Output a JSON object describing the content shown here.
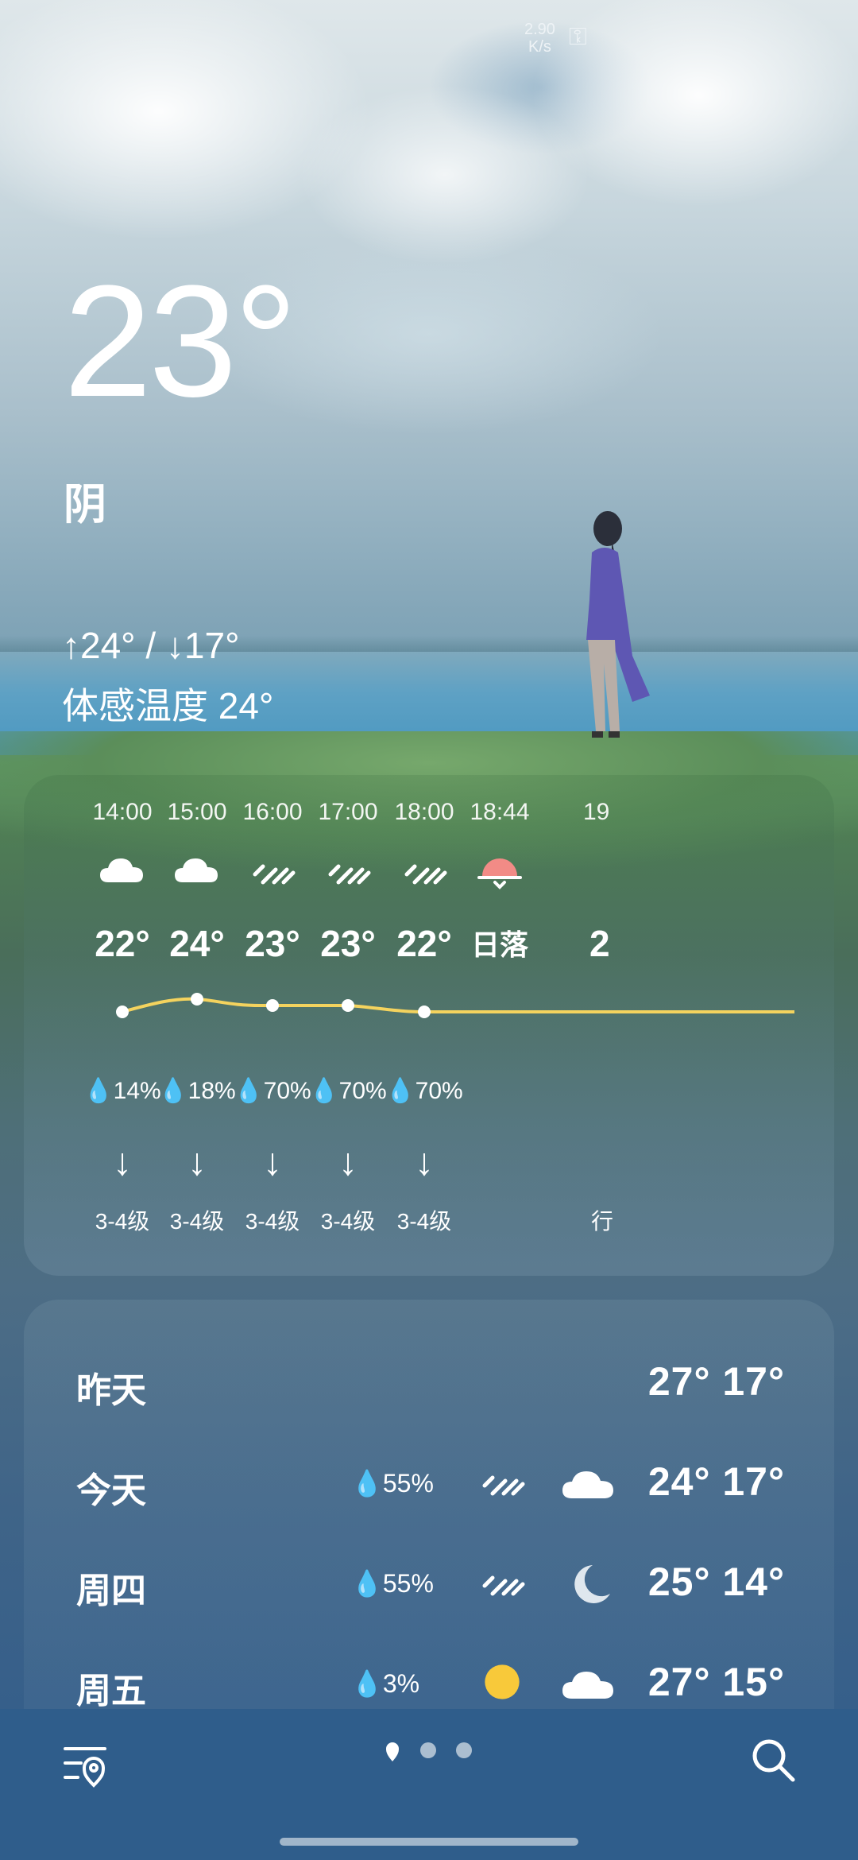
{
  "status_bar": {
    "net_speed": "2.90",
    "net_unit": "K/s",
    "key_icon": "key-icon"
  },
  "current": {
    "temperature": "23°",
    "condition": "阴",
    "high_low": "↑24° / ↓17°",
    "feels_like": "体感温度 24°"
  },
  "hourly": [
    {
      "time": "14:00",
      "icon": "cloud-icon",
      "temp": "22°",
      "precip": "14%",
      "wind_dir": "↓",
      "wind": "3-4级"
    },
    {
      "time": "15:00",
      "icon": "cloud-icon",
      "temp": "24°",
      "precip": "18%",
      "wind_dir": "↓",
      "wind": "3-4级"
    },
    {
      "time": "16:00",
      "icon": "rain-icon",
      "temp": "23°",
      "precip": "70%",
      "wind_dir": "↓",
      "wind": "3-4级"
    },
    {
      "time": "17:00",
      "icon": "rain-icon",
      "temp": "23°",
      "precip": "70%",
      "wind_dir": "↓",
      "wind": "3-4级"
    },
    {
      "time": "18:00",
      "icon": "rain-icon",
      "temp": "22°",
      "precip": "70%",
      "wind_dir": "↓",
      "wind": "3-4级"
    },
    {
      "time": "18:44",
      "icon": "sunset-icon",
      "temp": "日落",
      "precip": "",
      "wind_dir": "",
      "wind": ""
    },
    {
      "time": "19",
      "icon": "rain-icon",
      "temp": "2",
      "precip": "",
      "wind_dir": "",
      "wind": "行"
    }
  ],
  "daily": [
    {
      "day": "昨天",
      "precip": "",
      "icon_day": "",
      "icon_night": "",
      "temps": "27° 17°"
    },
    {
      "day": "今天",
      "precip": "55%",
      "icon_day": "rain-icon",
      "icon_night": "cloud-icon",
      "temps": "24° 17°"
    },
    {
      "day": "周四",
      "precip": "55%",
      "icon_day": "rain-icon",
      "icon_night": "moon-icon",
      "temps": "25° 14°"
    },
    {
      "day": "周五",
      "precip": "3%",
      "icon_day": "sun-icon",
      "icon_night": "cloud-icon",
      "temps": "27° 15°"
    }
  ],
  "colors": {
    "curve": "#f4d35e",
    "sun": "#f8c93a",
    "sunset": "#f28b86"
  }
}
